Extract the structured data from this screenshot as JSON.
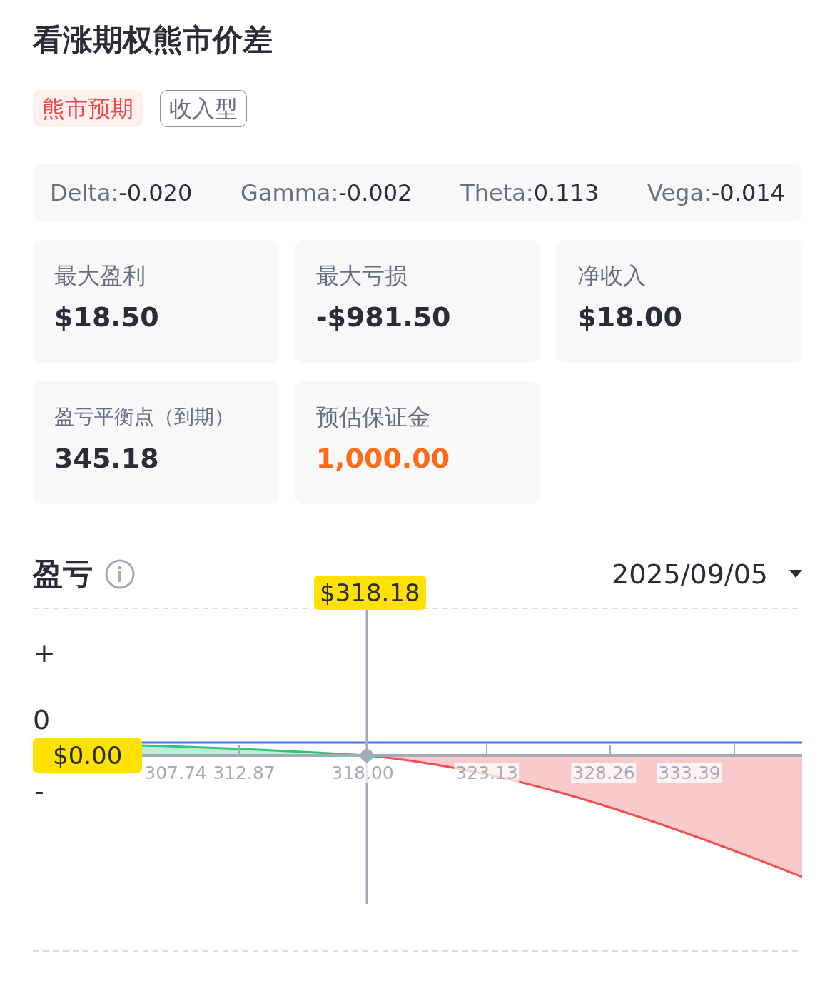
{
  "title": "看涨期权熊市价差",
  "tags": [
    {
      "label": "熊市预期",
      "kind": "bear"
    },
    {
      "label": "收入型",
      "kind": "outline"
    }
  ],
  "greeks": [
    {
      "label": "Delta:",
      "value": "-0.020"
    },
    {
      "label": "Gamma:",
      "value": "-0.002"
    },
    {
      "label": "Theta:",
      "value": "0.113"
    },
    {
      "label": "Vega:",
      "value": "-0.014"
    }
  ],
  "stats": [
    {
      "label": "最大盈利",
      "value": "$18.50",
      "highlight": false
    },
    {
      "label": "最大亏损",
      "value": "-$981.50",
      "highlight": false
    },
    {
      "label": "净收入",
      "value": "$18.00",
      "highlight": false
    },
    {
      "label": "盈亏平衡点（到期）",
      "value": "345.18",
      "highlight": false
    },
    {
      "label": "预估保证金",
      "value": "1,000.00",
      "highlight": true
    }
  ],
  "pnl": {
    "title": "盈亏",
    "date": "2025/09/05",
    "y_labels": [
      "+",
      "0",
      "-"
    ],
    "x_labels": [
      "307.74",
      "312.87",
      "318.00",
      "323.13",
      "328.26",
      "333.39"
    ],
    "cursor_price": "$318.18",
    "cursor_value": "$0.00"
  }
}
